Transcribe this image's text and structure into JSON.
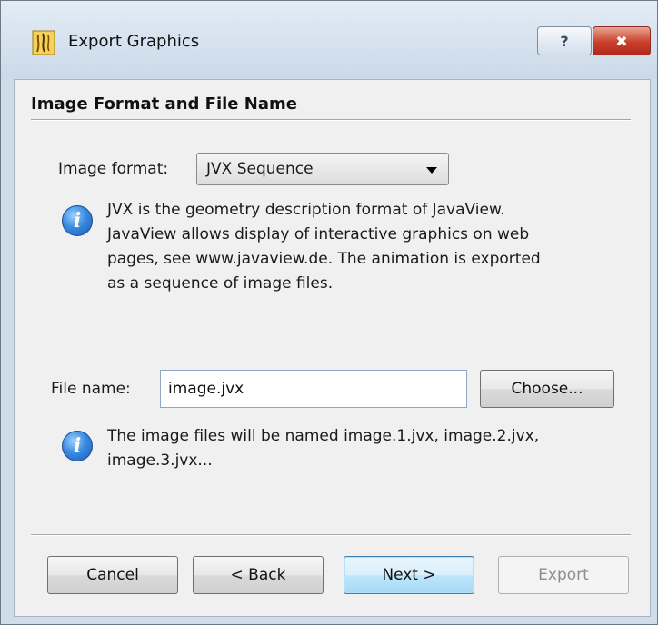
{
  "window": {
    "title": "Export Graphics",
    "help_label": "?",
    "close_label": "✖"
  },
  "page": {
    "heading": "Image Format and File Name"
  },
  "format": {
    "label": "Image format:",
    "selected": "JVX Sequence",
    "info_lines": [
      "JVX is the geometry description format of JavaView.",
      "JavaView allows display of interactive graphics on web",
      "pages, see www.javaview.de. The animation is exported",
      "as a sequence of image files."
    ]
  },
  "file": {
    "label": "File name:",
    "value": "image.jvx",
    "choose_label": "Choose...",
    "info_lines": [
      "The image files will be named image.1.jvx, image.2.jvx,",
      "image.3.jvx..."
    ]
  },
  "buttons": {
    "cancel": "Cancel",
    "back": "< Back",
    "next": "Next >",
    "export": "Export"
  },
  "icons": {
    "app": "javaview-app-icon",
    "info": "info-icon"
  },
  "colors": {
    "title_bar": "#cbd9e8",
    "close_button": "#c8402b",
    "default_button_border": "#3c7fb1",
    "info_icon": "#3a8be0"
  }
}
